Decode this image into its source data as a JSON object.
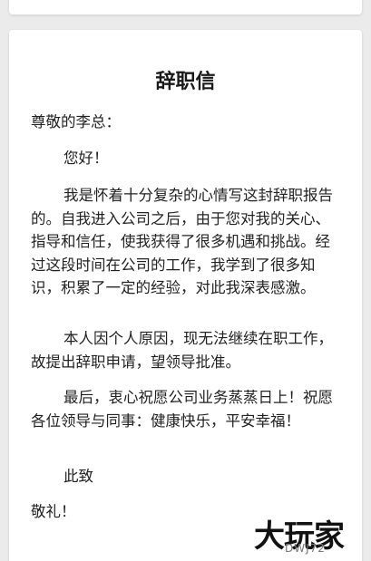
{
  "letter": {
    "title": "辞职信",
    "salutation": "尊敬的李总：",
    "greeting": "您好！",
    "paragraph1": "我是怀着十分复杂的心情写这封辞职报告的。自我进入公司之后，由于您对我的关心、指导和信任，使我获得了很多机遇和挑战。经过这段时间在公司的工作，我学到了很多知识，积累了一定的经验，对此我深表感激。",
    "paragraph2": "本人因个人原因，现无法继续在职工作，故提出辞职申请，望领导批准。",
    "paragraph3": "最后，衷心祝愿公司业务蒸蒸日上！祝愿各位领导与同事：健康快乐，平安幸福！",
    "closing": "此致",
    "regards": "敬礼！"
  },
  "watermark": {
    "logo_text": "大玩家",
    "sub_text": "DWJ72"
  }
}
